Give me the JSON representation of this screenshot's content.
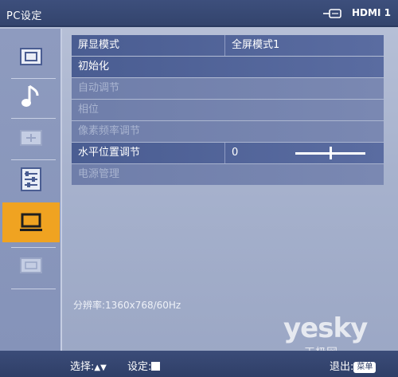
{
  "header": {
    "title": "PC设定",
    "source_icon": "input-connector-icon",
    "source_label": "HDMI 1"
  },
  "sidebar": {
    "items": [
      {
        "icon": "picture-icon",
        "active": false
      },
      {
        "icon": "music-note-icon",
        "active": false
      },
      {
        "icon": "screen-settings-icon",
        "active": false
      },
      {
        "icon": "setup-list-icon",
        "active": false
      },
      {
        "icon": "pc-monitor-icon",
        "active": true
      },
      {
        "icon": "channel-icon",
        "active": false
      }
    ]
  },
  "menu": {
    "rows": [
      {
        "label": "屏显模式",
        "value": "全屏模式1",
        "dim": false
      },
      {
        "label": "初始化",
        "value": "",
        "dim": false
      },
      {
        "label": "自动调节",
        "value": "",
        "dim": true
      },
      {
        "label": "相位",
        "value": "",
        "dim": true
      },
      {
        "label": "像素频率调节",
        "value": "",
        "dim": true
      },
      {
        "label": "水平位置调节",
        "value": "0",
        "dim": false,
        "slider_level": 0.5
      },
      {
        "label": "电源管理",
        "value": "",
        "dim": true
      }
    ]
  },
  "info": {
    "resolution": "分辨率:1360x768/60Hz"
  },
  "footer": {
    "select_label": "选择:",
    "select_arrows": "▲▼",
    "set_label": "设定:",
    "exit_label": "退出:",
    "exit_badge": "菜单"
  },
  "watermark": {
    "logo": "yesky",
    "sub": "天极网"
  },
  "colors": {
    "accent": "#f0a321",
    "header": "#3d4f7c",
    "row": "#4a5d92"
  }
}
